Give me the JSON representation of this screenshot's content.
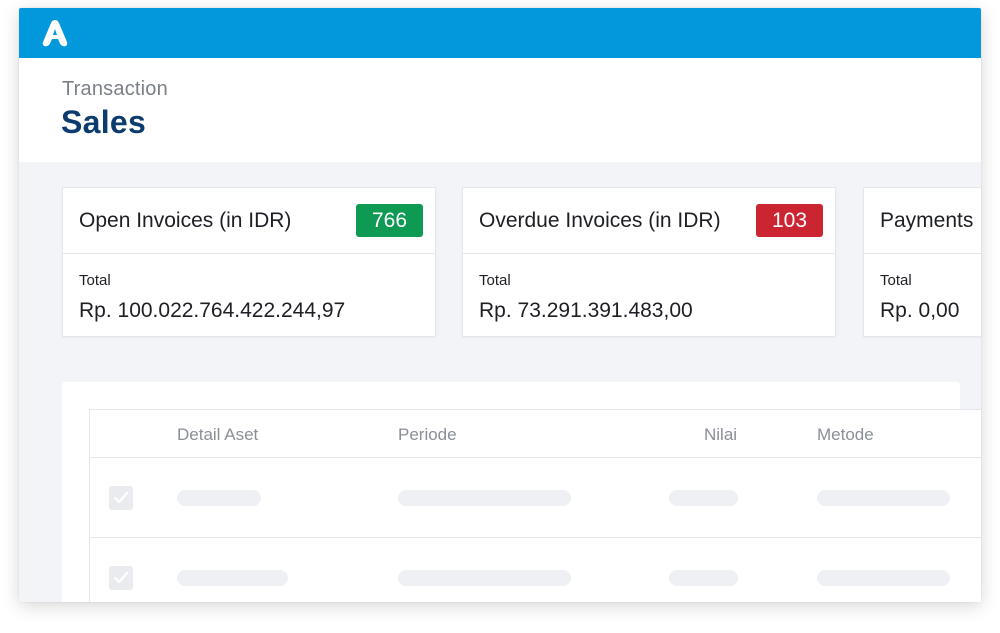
{
  "app": {
    "logo_icon": "app-logo-icon",
    "topbar_color": "#0398dc"
  },
  "header": {
    "breadcrumb": "Transaction",
    "title": "Sales"
  },
  "cards": [
    {
      "title": "Open Invoices (in IDR)",
      "badge": "766",
      "badge_color": "#0e9a53",
      "total_label": "Total",
      "total_value": "Rp. 100.022.764.422.244,97"
    },
    {
      "title": "Overdue Invoices (in IDR)",
      "badge": "103",
      "badge_color": "#cc2532",
      "total_label": "Total",
      "total_value": "Rp. 73.291.391.483,00"
    },
    {
      "title": "Payments",
      "total_label": "Total",
      "total_value": "Rp. 0,00"
    }
  ],
  "table": {
    "columns": [
      "Detail Aset",
      "Periode",
      "Nilai",
      "Metode"
    ],
    "checkbox_icon": "check-icon"
  }
}
